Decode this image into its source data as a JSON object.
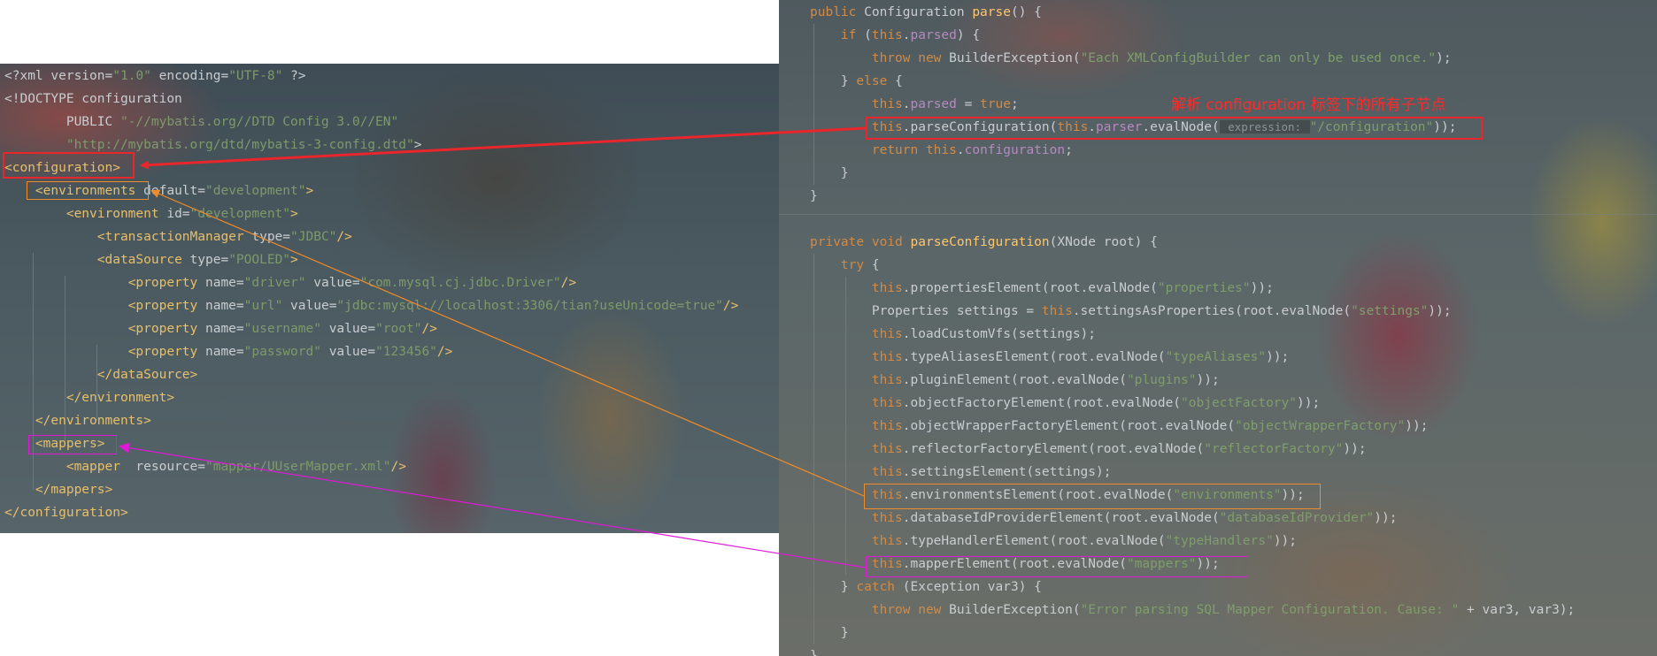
{
  "xml_editor": {
    "lines": [
      [
        [
          "t-plain",
          "<?xml version="
        ],
        [
          "t-val",
          "\"1.0\""
        ],
        [
          "t-plain",
          " encoding="
        ],
        [
          "t-val",
          "\"UTF-8\""
        ],
        [
          "t-plain",
          " ?>"
        ]
      ],
      [
        [
          "t-plain",
          "<!DOCTYPE configuration"
        ]
      ],
      [
        [
          "t-plain",
          "        PUBLIC "
        ],
        [
          "t-val",
          "\"-//mybatis.org//DTD Config 3.0//EN\""
        ]
      ],
      [
        [
          "t-plain",
          "        "
        ],
        [
          "t-val",
          "\"http://mybatis.org/dtd/mybatis-3-config.dtd\""
        ],
        [
          "t-plain",
          ">"
        ]
      ],
      [
        [
          "t-tag",
          "<configuration>"
        ]
      ],
      [
        [
          "t-plain",
          "    "
        ],
        [
          "t-tag",
          "<environments"
        ],
        [
          "t-attr",
          " default="
        ],
        [
          "t-val",
          "\"development\""
        ],
        [
          "t-tag",
          ">"
        ]
      ],
      [
        [
          "t-plain",
          "        "
        ],
        [
          "t-tag",
          "<environment"
        ],
        [
          "t-attr",
          " id="
        ],
        [
          "t-val",
          "\"development\""
        ],
        [
          "t-tag",
          ">"
        ]
      ],
      [
        [
          "t-plain",
          "            "
        ],
        [
          "t-tag",
          "<transactionManager"
        ],
        [
          "t-attr",
          " type="
        ],
        [
          "t-val",
          "\"JDBC\""
        ],
        [
          "t-tag",
          "/>"
        ]
      ],
      [
        [
          "t-plain",
          "            "
        ],
        [
          "t-tag",
          "<dataSource"
        ],
        [
          "t-attr",
          " type="
        ],
        [
          "t-val",
          "\"POOLED\""
        ],
        [
          "t-tag",
          ">"
        ]
      ],
      [
        [
          "t-plain",
          "                "
        ],
        [
          "t-tag",
          "<property"
        ],
        [
          "t-attr",
          " name="
        ],
        [
          "t-val",
          "\"driver\""
        ],
        [
          "t-attr",
          " value="
        ],
        [
          "t-val",
          "\"com.mysql.cj.jdbc.Driver\""
        ],
        [
          "t-tag",
          "/>"
        ]
      ],
      [
        [
          "t-plain",
          "                "
        ],
        [
          "t-tag",
          "<property"
        ],
        [
          "t-attr",
          " name="
        ],
        [
          "t-val",
          "\"url\""
        ],
        [
          "t-attr",
          " value="
        ],
        [
          "t-val",
          "\"jdbc:mysql://localhost:3306/tian?useUnicode=true\""
        ],
        [
          "t-tag",
          "/>"
        ]
      ],
      [
        [
          "t-plain",
          "                "
        ],
        [
          "t-tag",
          "<property"
        ],
        [
          "t-attr",
          " name="
        ],
        [
          "t-val",
          "\"username\""
        ],
        [
          "t-attr",
          " value="
        ],
        [
          "t-val",
          "\"root\""
        ],
        [
          "t-tag",
          "/>"
        ]
      ],
      [
        [
          "t-plain",
          "                "
        ],
        [
          "t-tag",
          "<property"
        ],
        [
          "t-attr",
          " name="
        ],
        [
          "t-val",
          "\"password\""
        ],
        [
          "t-attr",
          " value="
        ],
        [
          "t-val",
          "\"123456\""
        ],
        [
          "t-tag",
          "/>"
        ]
      ],
      [
        [
          "t-plain",
          "            "
        ],
        [
          "t-tag",
          "</dataSource>"
        ]
      ],
      [
        [
          "t-plain",
          "        "
        ],
        [
          "t-tag",
          "</environment>"
        ]
      ],
      [
        [
          "t-plain",
          "    "
        ],
        [
          "t-tag",
          "</environments>"
        ]
      ],
      [
        [
          "t-plain",
          "    "
        ],
        [
          "t-tag",
          "<mappers>"
        ]
      ],
      [
        [
          "t-plain",
          "        "
        ],
        [
          "t-tag",
          "<mapper"
        ],
        [
          "t-attr",
          "  resource="
        ],
        [
          "t-val",
          "\"mapper/UUserMapper.xml\""
        ],
        [
          "t-tag",
          "/>"
        ]
      ],
      [
        [
          "t-plain",
          "    "
        ],
        [
          "t-tag",
          "</mappers>"
        ]
      ],
      [
        [
          "t-tag",
          "</configuration>"
        ]
      ]
    ]
  },
  "java_editor": {
    "lines": [
      [
        [
          "t-kw",
          "public "
        ],
        [
          "t-plain",
          "Configuration "
        ],
        [
          "t-fn",
          "parse"
        ],
        [
          "t-plain",
          "() {"
        ]
      ],
      [
        [
          "t-plain",
          "    "
        ],
        [
          "t-kw",
          "if "
        ],
        [
          "t-plain",
          "("
        ],
        [
          "t-kw",
          "this"
        ],
        [
          "t-plain",
          "."
        ],
        [
          "t-field",
          "parsed"
        ],
        [
          "t-plain",
          ") {"
        ]
      ],
      [
        [
          "t-plain",
          "        "
        ],
        [
          "t-kw",
          "throw new "
        ],
        [
          "t-plain",
          "BuilderException("
        ],
        [
          "t-str",
          "\"Each XMLConfigBuilder can only be used once.\""
        ],
        [
          "t-plain",
          ");"
        ]
      ],
      [
        [
          "t-plain",
          "    } "
        ],
        [
          "t-kw",
          "else "
        ],
        [
          "t-plain",
          "{"
        ]
      ],
      [
        [
          "t-plain",
          "        "
        ],
        [
          "t-kw",
          "this"
        ],
        [
          "t-plain",
          "."
        ],
        [
          "t-field",
          "parsed"
        ],
        [
          "t-plain",
          " = "
        ],
        [
          "t-kw",
          "true"
        ],
        [
          "t-plain",
          ";"
        ]
      ],
      [
        [
          "t-plain",
          "        "
        ],
        [
          "t-kw",
          "this"
        ],
        [
          "t-plain",
          ".parseConfiguration("
        ],
        [
          "t-kw",
          "this"
        ],
        [
          "t-plain",
          "."
        ],
        [
          "t-field",
          "parser"
        ],
        [
          "t-plain",
          ".evalNode("
        ],
        [
          "t-hint",
          " expression: "
        ],
        [
          "t-str",
          "\"/configuration\""
        ],
        [
          "t-plain",
          "));"
        ]
      ],
      [
        [
          "t-plain",
          "        "
        ],
        [
          "t-kw",
          "return this"
        ],
        [
          "t-plain",
          "."
        ],
        [
          "t-field",
          "configuration"
        ],
        [
          "t-plain",
          ";"
        ]
      ],
      [
        [
          "t-plain",
          "    }"
        ]
      ],
      [
        [
          "t-plain",
          "}"
        ]
      ],
      [
        [
          "t-plain",
          ""
        ]
      ],
      [
        [
          "t-kw",
          "private void "
        ],
        [
          "t-fn",
          "parseConfiguration"
        ],
        [
          "t-plain",
          "(XNode root) {"
        ]
      ],
      [
        [
          "t-plain",
          "    "
        ],
        [
          "t-kw",
          "try "
        ],
        [
          "t-plain",
          "{"
        ]
      ],
      [
        [
          "t-plain",
          "        "
        ],
        [
          "t-kw",
          "this"
        ],
        [
          "t-plain",
          ".propertiesElement(root.evalNode("
        ],
        [
          "t-str",
          "\"properties\""
        ],
        [
          "t-plain",
          "));"
        ]
      ],
      [
        [
          "t-plain",
          "        Properties settings = "
        ],
        [
          "t-kw",
          "this"
        ],
        [
          "t-plain",
          ".settingsAsProperties(root.evalNode("
        ],
        [
          "t-str",
          "\"settings\""
        ],
        [
          "t-plain",
          "));"
        ]
      ],
      [
        [
          "t-plain",
          "        "
        ],
        [
          "t-kw",
          "this"
        ],
        [
          "t-plain",
          ".loadCustomVfs(settings);"
        ]
      ],
      [
        [
          "t-plain",
          "        "
        ],
        [
          "t-kw",
          "this"
        ],
        [
          "t-plain",
          ".typeAliasesElement(root.evalNode("
        ],
        [
          "t-str",
          "\"typeAliases\""
        ],
        [
          "t-plain",
          "));"
        ]
      ],
      [
        [
          "t-plain",
          "        "
        ],
        [
          "t-kw",
          "this"
        ],
        [
          "t-plain",
          ".pluginElement(root.evalNode("
        ],
        [
          "t-str",
          "\"plugins\""
        ],
        [
          "t-plain",
          "));"
        ]
      ],
      [
        [
          "t-plain",
          "        "
        ],
        [
          "t-kw",
          "this"
        ],
        [
          "t-plain",
          ".objectFactoryElement(root.evalNode("
        ],
        [
          "t-str",
          "\"objectFactory\""
        ],
        [
          "t-plain",
          "));"
        ]
      ],
      [
        [
          "t-plain",
          "        "
        ],
        [
          "t-kw",
          "this"
        ],
        [
          "t-plain",
          ".objectWrapperFactoryElement(root.evalNode("
        ],
        [
          "t-str",
          "\"objectWrapperFactory\""
        ],
        [
          "t-plain",
          "));"
        ]
      ],
      [
        [
          "t-plain",
          "        "
        ],
        [
          "t-kw",
          "this"
        ],
        [
          "t-plain",
          ".reflectorFactoryElement(root.evalNode("
        ],
        [
          "t-str",
          "\"reflectorFactory\""
        ],
        [
          "t-plain",
          "));"
        ]
      ],
      [
        [
          "t-plain",
          "        "
        ],
        [
          "t-kw",
          "this"
        ],
        [
          "t-plain",
          ".settingsElement(settings);"
        ]
      ],
      [
        [
          "t-plain",
          "        "
        ],
        [
          "t-kw",
          "this"
        ],
        [
          "t-plain",
          ".environmentsElement(root.evalNode("
        ],
        [
          "t-str",
          "\"environments\""
        ],
        [
          "t-plain",
          "));"
        ]
      ],
      [
        [
          "t-plain",
          "        "
        ],
        [
          "t-kw",
          "this"
        ],
        [
          "t-plain",
          ".databaseIdProviderElement(root.evalNode("
        ],
        [
          "t-str",
          "\"databaseIdProvider\""
        ],
        [
          "t-plain",
          "));"
        ]
      ],
      [
        [
          "t-plain",
          "        "
        ],
        [
          "t-kw",
          "this"
        ],
        [
          "t-plain",
          ".typeHandlerElement(root.evalNode("
        ],
        [
          "t-str",
          "\"typeHandlers\""
        ],
        [
          "t-plain",
          "));"
        ]
      ],
      [
        [
          "t-plain",
          "        "
        ],
        [
          "t-kw",
          "this"
        ],
        [
          "t-plain",
          ".mapperElement(root.evalNode("
        ],
        [
          "t-str",
          "\"mappers\""
        ],
        [
          "t-plain",
          "));"
        ]
      ],
      [
        [
          "t-plain",
          "    } "
        ],
        [
          "t-kw",
          "catch "
        ],
        [
          "t-plain",
          "(Exception var3) {"
        ]
      ],
      [
        [
          "t-plain",
          "        "
        ],
        [
          "t-kw",
          "throw new "
        ],
        [
          "t-plain",
          "BuilderException("
        ],
        [
          "t-str",
          "\"Error parsing SQL Mapper Configuration. Cause: \""
        ],
        [
          "t-plain",
          " + var3, var3);"
        ]
      ],
      [
        [
          "t-plain",
          "    }"
        ]
      ],
      [
        [
          "t-plain",
          "}"
        ]
      ]
    ]
  },
  "annotation": {
    "text": "解析 configuration 标签下的所有子节点",
    "color": "#ff2a2a"
  },
  "highlight_colors": {
    "red": "#e8262b",
    "orange": "#f08c2a",
    "magenta": "#e018d8"
  }
}
